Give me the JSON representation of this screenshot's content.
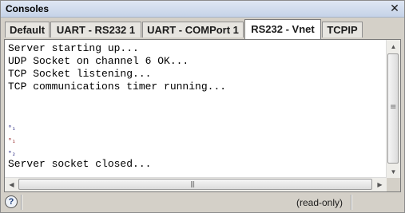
{
  "window": {
    "title": "Consoles",
    "close_glyph": "✕"
  },
  "tabs": [
    {
      "label": "Default",
      "active": false
    },
    {
      "label": "UART - RS232 1",
      "active": false
    },
    {
      "label": "UART - COMPort 1",
      "active": false
    },
    {
      "label": "RS232 - Vnet",
      "active": true
    },
    {
      "label": "TCPIP",
      "active": false
    }
  ],
  "console": {
    "lines": [
      {
        "text": "Server starting up...",
        "kind": "text"
      },
      {
        "text": "UDP Socket on channel 6 OK...",
        "kind": "text"
      },
      {
        "text": "TCP Socket listening...",
        "kind": "text"
      },
      {
        "text": "TCP communications timer running...",
        "kind": "text"
      },
      {
        "text": "°₁",
        "kind": "ctrl",
        "color": "#1a1a7a"
      },
      {
        "text": "°₁",
        "kind": "ctrl",
        "color": "#8a1010"
      },
      {
        "text": "°₂",
        "kind": "ctrl",
        "color": "#1a1a7a"
      },
      {
        "text": "Server socket closed...",
        "kind": "text"
      }
    ]
  },
  "scrollbars": {
    "up_glyph": "▲",
    "down_glyph": "▼",
    "left_glyph": "◀",
    "right_glyph": "▶",
    "vgrip_glyph": "≡",
    "hgrip_glyph": "|||"
  },
  "statusbar": {
    "help_glyph": "?",
    "status": "(read-only)"
  },
  "colors": {
    "accent_title": "#c5d3e8",
    "background": "#d4d0c8",
    "console_bg": "#ffffff"
  }
}
